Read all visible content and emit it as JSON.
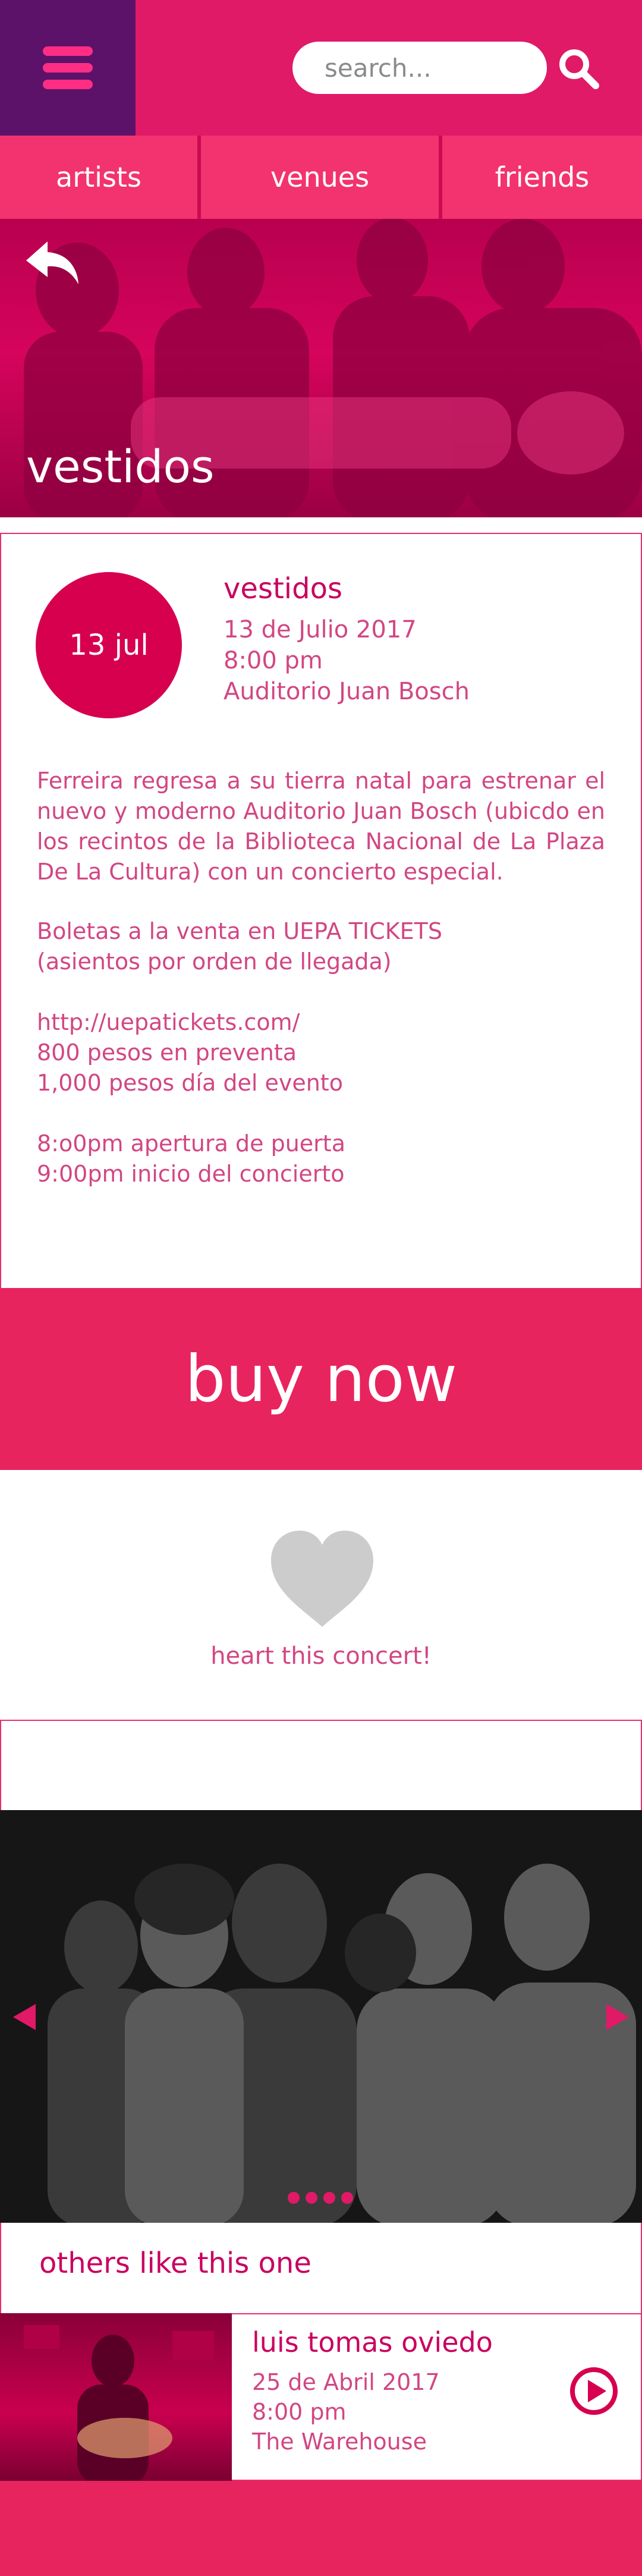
{
  "header": {
    "search_placeholder": "search..."
  },
  "nav": {
    "tabs": [
      "artists",
      "venues",
      "friends"
    ]
  },
  "hero": {
    "title": "vestidos"
  },
  "event": {
    "date_badge": "13 jul",
    "title": "vestidos",
    "date": "13 de Julio 2017",
    "time": "8:00 pm",
    "venue": "Auditorio Juan Bosch",
    "description": "Ferreira regresa a su tierra natal para estrenar el nuevo y moderno Auditorio Juan Bosch (ubicdo en los recintos de la Biblioteca Nacional de La Plaza De La Cultura) con un concierto especial.",
    "tickets_line1": "Boletas a la venta en UEPA TICKETS",
    "tickets_line2": "(asientos por orden de llegada)",
    "url": "http://uepatickets.com/",
    "presale": "800 pesos en preventa",
    "day_price": "1,000 pesos día del evento",
    "doors": "8:o0pm apertura de puerta",
    "start": "9:00pm inicio del concierto"
  },
  "buy_label": "buy now",
  "heart_label": "heart this concert!",
  "carousel": {
    "dot_count": 4
  },
  "others": {
    "title": "others like this one",
    "items": [
      {
        "title": "luis tomas oviedo",
        "date": "25 de Abril 2017",
        "time": "8:00 pm",
        "venue": "The Warehouse"
      }
    ]
  },
  "colors": {
    "primary": "#e01a67",
    "menu_bg": "#5c1268",
    "accent_text": "#c9005f",
    "heart": "#cccccc"
  },
  "icons": [
    "hamburger-menu-icon",
    "search-icon",
    "back-arrow-icon",
    "heart-icon",
    "chevron-left-icon",
    "chevron-right-icon",
    "play-icon"
  ]
}
